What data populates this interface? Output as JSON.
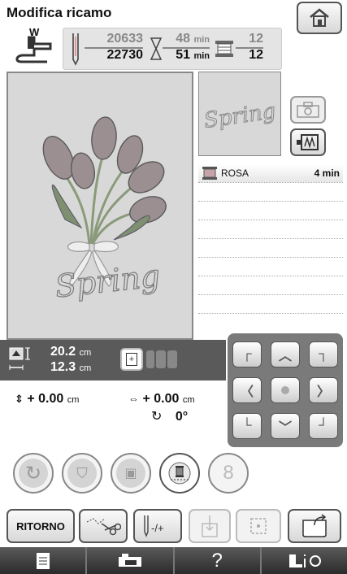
{
  "title": "Modifica ricamo",
  "status": {
    "presser_foot": "W",
    "stitches_current": "20633",
    "stitches_total": "22730",
    "time_current": "48",
    "time_total": "51",
    "time_unit": "min",
    "colors_current": "12",
    "colors_total": "12"
  },
  "thumbnail_text": "Spring",
  "design_text": "Spring",
  "thread_list": [
    {
      "name": "ROSA",
      "time": "4 min"
    }
  ],
  "info": {
    "height": "20.2",
    "width": "12.3",
    "unit": "cm",
    "move_v": "+ 0.00",
    "move_h": "+ 0.00",
    "rotation": "0°"
  },
  "buttons": {
    "return": "RITORNO",
    "help_glyph": "?"
  }
}
